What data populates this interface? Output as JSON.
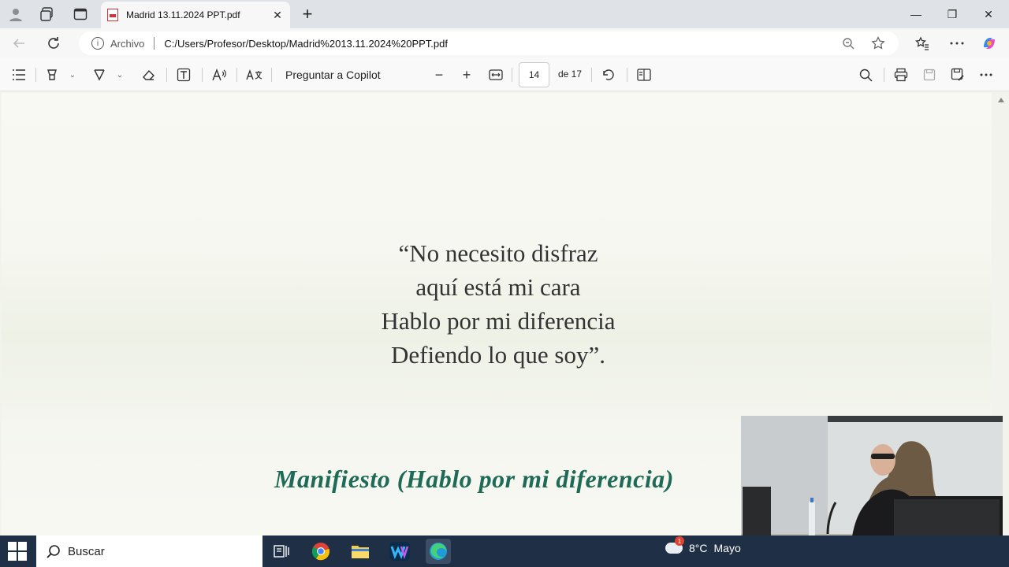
{
  "browser": {
    "tab": {
      "title": "Madrid 13.11.2024 PPT.pdf",
      "close": "✕"
    },
    "new_tab": "+",
    "window": {
      "minimize": "—",
      "restore": "❐",
      "close": "✕"
    },
    "address": {
      "site_label": "Archivo",
      "url": "C:/Users/Profesor/Desktop/Madrid%2013.11.2024%20PPT.pdf"
    }
  },
  "pdf_toolbar": {
    "copilot_label": "Preguntar a Copilot",
    "zoom_out": "−",
    "zoom_in": "+",
    "current_page": "14",
    "page_count": "de 17"
  },
  "slide": {
    "poem_lines": [
      "“No necesito disfraz",
      "aquí está mi cara",
      "Hablo por mi diferencia",
      "Defiendo lo que soy”."
    ],
    "title": "Manifiesto (Hablo por mi diferencia)",
    "title_color": "#1e6a57"
  },
  "taskbar": {
    "search_placeholder": "Buscar",
    "weather": {
      "temp": "8°C",
      "condition": "Mayo",
      "alert_count": "1"
    }
  }
}
